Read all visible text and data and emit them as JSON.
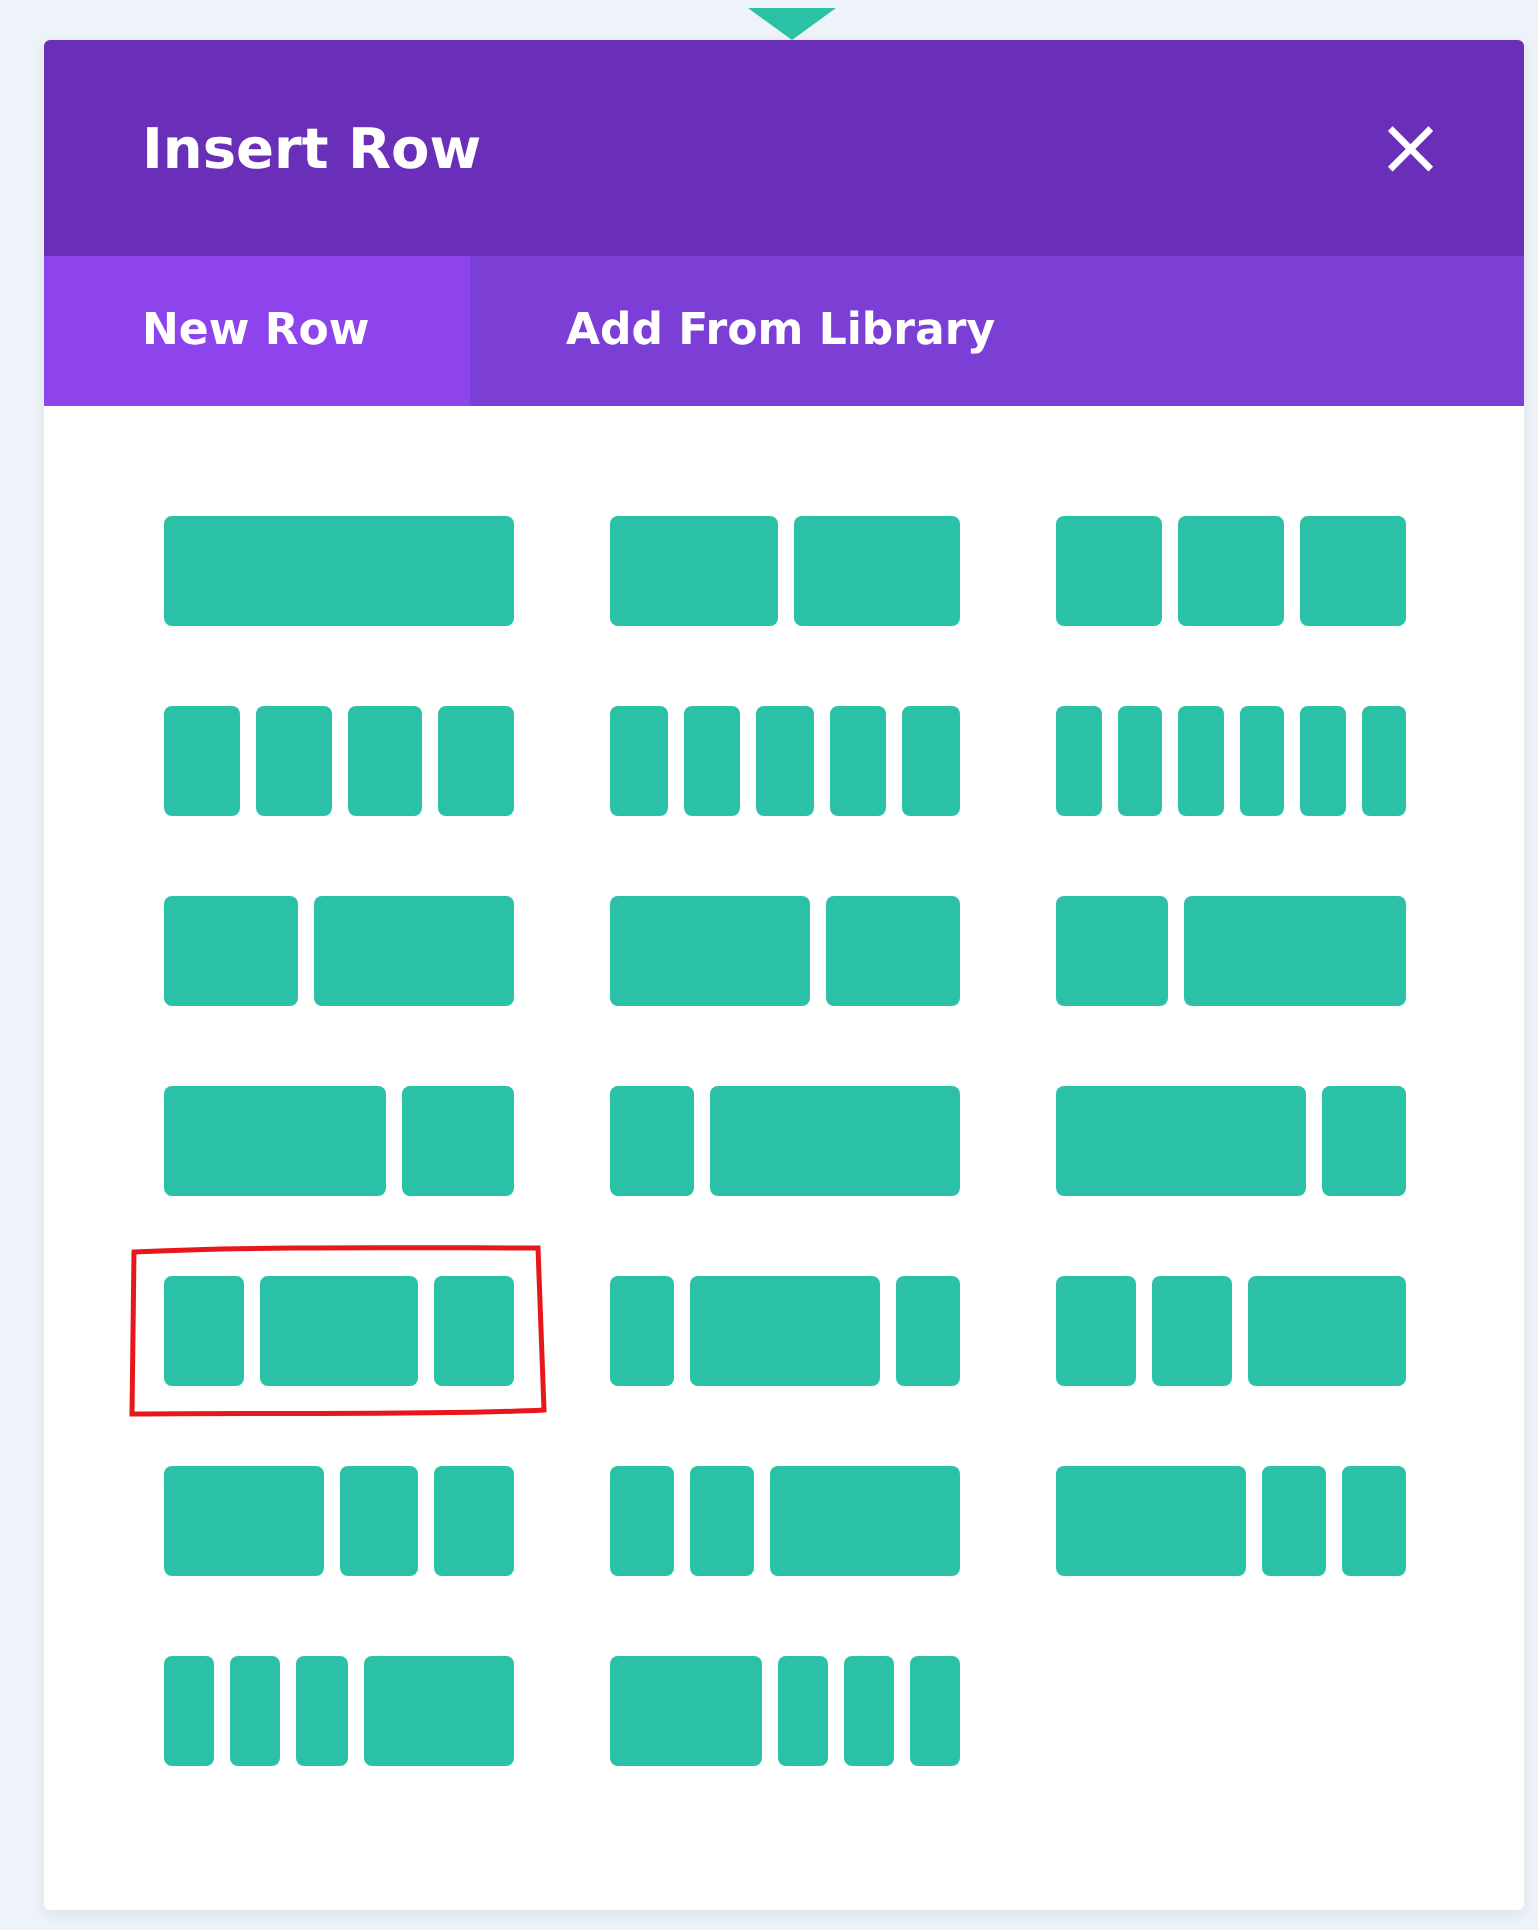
{
  "modal": {
    "title": "Insert Row",
    "close": "×"
  },
  "tabs": [
    {
      "label": "New Row",
      "selected": true
    },
    {
      "label": "Add From Library",
      "selected": false
    }
  ],
  "layouts": [
    {
      "columns": [
        {
          "kind": "full"
        }
      ],
      "circled": false
    },
    {
      "columns": [
        {
          "kind": "half"
        },
        {
          "kind": "half"
        }
      ],
      "circled": false
    },
    {
      "columns": [
        {
          "kind": "third"
        },
        {
          "kind": "third"
        },
        {
          "kind": "third"
        }
      ],
      "circled": false
    },
    {
      "columns": [
        {
          "kind": "quarter"
        },
        {
          "kind": "quarter"
        },
        {
          "kind": "quarter"
        },
        {
          "kind": "quarter"
        }
      ],
      "circled": false
    },
    {
      "columns": [
        {
          "kind": "fifth"
        },
        {
          "kind": "fifth"
        },
        {
          "kind": "fifth"
        },
        {
          "kind": "fifth"
        },
        {
          "kind": "fifth"
        }
      ],
      "circled": false
    },
    {
      "columns": [
        {
          "kind": "sixth"
        },
        {
          "kind": "sixth"
        },
        {
          "kind": "sixth"
        },
        {
          "kind": "sixth"
        },
        {
          "kind": "sixth"
        },
        {
          "kind": "sixth"
        }
      ],
      "circled": false
    },
    {
      "columns": [
        {
          "kind": "twofifths"
        },
        {
          "kind": "threefifths"
        }
      ],
      "circled": false
    },
    {
      "columns": [
        {
          "kind": "threefifths"
        },
        {
          "kind": "twofifths"
        }
      ],
      "circled": false
    },
    {
      "columns": [
        {
          "kind": "third"
        },
        {
          "kind": "twothirds"
        }
      ],
      "circled": false
    },
    {
      "columns": [
        {
          "kind": "twothirds"
        },
        {
          "kind": "third"
        }
      ],
      "circled": false
    },
    {
      "columns": [
        {
          "kind": "quarter"
        },
        {
          "kind": "threequarters"
        }
      ],
      "circled": false
    },
    {
      "columns": [
        {
          "kind": "threequarters"
        },
        {
          "kind": "quarter"
        }
      ],
      "circled": false
    },
    {
      "columns": [
        {
          "kind": "quarter"
        },
        {
          "kind": "half"
        },
        {
          "kind": "quarter"
        }
      ],
      "circled": true
    },
    {
      "columns": [
        {
          "kind": "fifth"
        },
        {
          "kind": "threefifths"
        },
        {
          "kind": "fifth"
        }
      ],
      "circled": false
    },
    {
      "columns": [
        {
          "kind": "quarter"
        },
        {
          "kind": "quarter"
        },
        {
          "kind": "half"
        }
      ],
      "circled": false
    },
    {
      "columns": [
        {
          "kind": "half"
        },
        {
          "kind": "quarter"
        },
        {
          "kind": "quarter"
        }
      ],
      "circled": false
    },
    {
      "columns": [
        {
          "kind": "fifth"
        },
        {
          "kind": "fifth"
        },
        {
          "kind": "threefifths"
        }
      ],
      "circled": false
    },
    {
      "columns": [
        {
          "kind": "threefifths"
        },
        {
          "kind": "fifth"
        },
        {
          "kind": "fifth"
        }
      ],
      "circled": false
    },
    {
      "columns": [
        {
          "kind": "sixth"
        },
        {
          "kind": "sixth"
        },
        {
          "kind": "sixth"
        },
        {
          "kind": "half"
        }
      ],
      "circled": false
    },
    {
      "columns": [
        {
          "kind": "half"
        },
        {
          "kind": "sixth"
        },
        {
          "kind": "sixth"
        },
        {
          "kind": "sixth"
        }
      ],
      "circled": false
    }
  ]
}
